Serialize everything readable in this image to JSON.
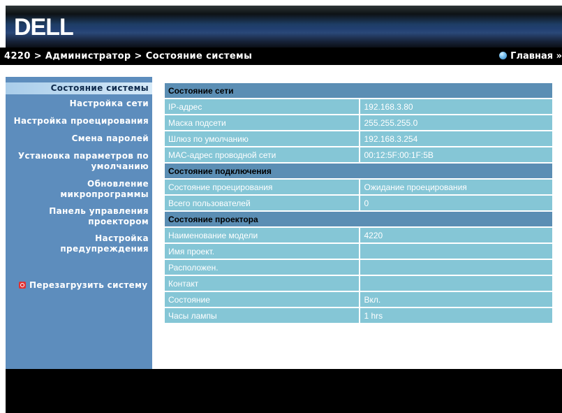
{
  "logo_text": "DELL",
  "breadcrumb": "4220 > Администратор > Состояние системы",
  "home_label": "Главная »",
  "sidebar": {
    "items": [
      {
        "label": "Состояние системы",
        "active": true
      },
      {
        "label": "Настройка сети"
      },
      {
        "label": "Настройка проецирования"
      },
      {
        "label": "Смена паролей"
      },
      {
        "label": "Установка параметров по умолчанию"
      },
      {
        "label": "Обновление микропрограммы"
      },
      {
        "label": "Панель управления проектором"
      },
      {
        "label": "Настройка предупреждения"
      }
    ],
    "reboot_label": "Перезагрузить систему"
  },
  "network": {
    "title": "Состояние сети",
    "rows": [
      {
        "label": "IP-адрес",
        "value": "192.168.3.80"
      },
      {
        "label": "Маска подсети",
        "value": "255.255.255.0"
      },
      {
        "label": "Шлюз по умолчанию",
        "value": "192.168.3.254"
      },
      {
        "label": "MAC-адрес проводной сети",
        "value": "00:12:5F:00:1F:5B"
      }
    ]
  },
  "connection": {
    "title": "Состояние подключения",
    "rows": [
      {
        "label": "Состояние проецирования",
        "value": "Ожидание проецирования"
      },
      {
        "label": "Всего пользователей",
        "value": "0"
      }
    ]
  },
  "projector": {
    "title": "Состояние проектора",
    "rows": [
      {
        "label": "Наименование модели",
        "value": "4220"
      },
      {
        "label": "Имя проект.",
        "value": ""
      },
      {
        "label": "Расположен.",
        "value": ""
      },
      {
        "label": "Контакт",
        "value": ""
      },
      {
        "label": "Состояние",
        "value": "Вкл."
      },
      {
        "label": "Часы лампы",
        "value": "1 hrs"
      }
    ]
  }
}
